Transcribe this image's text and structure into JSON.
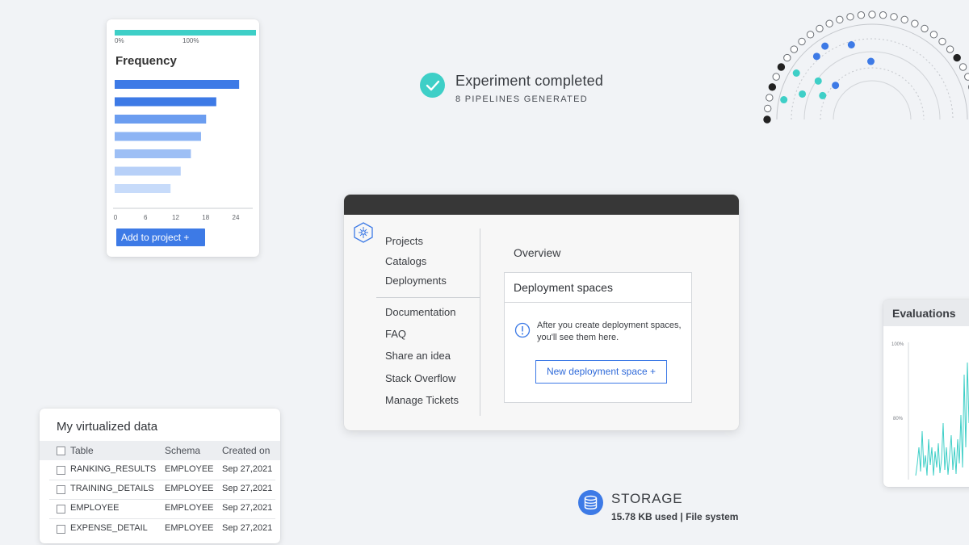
{
  "frequency_card": {
    "progress": {
      "label_start": "0%",
      "label_end": "100%",
      "value_percent": 100,
      "color": "#3ecfc7"
    },
    "title": "Frequency",
    "add_button_label": "Add to project  +",
    "chart_data": {
      "type": "bar",
      "orientation": "horizontal",
      "title": "Frequency",
      "xlim": [
        0,
        24
      ],
      "x_ticks": [
        "0",
        "6",
        "12",
        "18",
        "24"
      ],
      "values": [
        24.5,
        20,
        18,
        17,
        15,
        13,
        11
      ],
      "colors": [
        "#3d7ae6",
        "#3d7ae6",
        "#6b9df0",
        "#8db4f4",
        "#9dbff5",
        "#b7d0f8",
        "#c7dbfa"
      ]
    }
  },
  "experiment": {
    "title": "Experiment completed",
    "subtitle": "8 PIPELINES GENERATED",
    "accent": "#3ecfc7",
    "icon": "checkmark-icon"
  },
  "main_window": {
    "nav_primary": [
      "Projects",
      "Catalogs",
      "Deployments"
    ],
    "nav_secondary": [
      "Documentation",
      "FAQ",
      "Share an idea",
      "Stack Overflow",
      "Manage Tickets"
    ],
    "overview_label": "Overview",
    "deployment_card": {
      "title": "Deployment spaces",
      "message": "After you create deployment spaces, you'll see them here.",
      "button_label": "New deployment space  +"
    }
  },
  "virtualized_data": {
    "title": "My virtualized data",
    "columns": [
      "Table",
      "Schema",
      "Created on"
    ],
    "rows": [
      [
        "RANKING_RESULTS",
        "EMPLOYEE",
        "Sep 27,2021"
      ],
      [
        "TRAINING_DETAILS",
        "EMPLOYEE",
        "Sep 27,2021"
      ],
      [
        "EMPLOYEE",
        "EMPLOYEE",
        "Sep 27,2021"
      ],
      [
        "EXPENSE_DETAIL",
        "EMPLOYEE",
        "Sep 27,2021"
      ]
    ]
  },
  "evaluations": {
    "title": "Evaluations",
    "tick_top": "100%",
    "tick_mid": "80%",
    "line_color": "#3ecfc7"
  },
  "storage": {
    "title": "STORAGE",
    "subtitle": "15.78 KB used | File system",
    "accent": "#3d7ae6",
    "icon": "database-icon"
  },
  "colors": {
    "teal": "#3ecfc7",
    "blue": "#3d7ae6",
    "dark": "#373737",
    "background": "#f1f3f6"
  }
}
